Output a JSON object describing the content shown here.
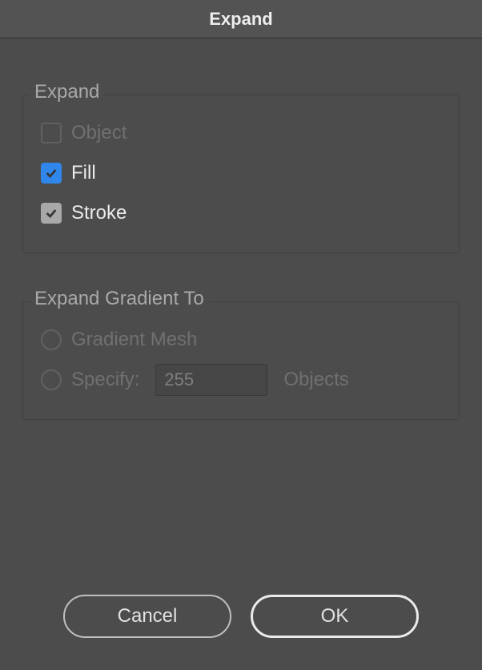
{
  "title": "Expand",
  "group1": {
    "legend": "Expand",
    "object": {
      "label": "Object",
      "checked": false,
      "enabled": false
    },
    "fill": {
      "label": "Fill",
      "checked": true,
      "enabled": true
    },
    "stroke": {
      "label": "Stroke",
      "checked": true,
      "enabled": true
    }
  },
  "group2": {
    "legend": "Expand Gradient To",
    "gradient_mesh": {
      "label": "Gradient Mesh",
      "selected": false,
      "enabled": false
    },
    "specify": {
      "label": "Specify:",
      "value": "255",
      "suffix": "Objects",
      "selected": false,
      "enabled": false
    }
  },
  "buttons": {
    "cancel": "Cancel",
    "ok": "OK"
  }
}
